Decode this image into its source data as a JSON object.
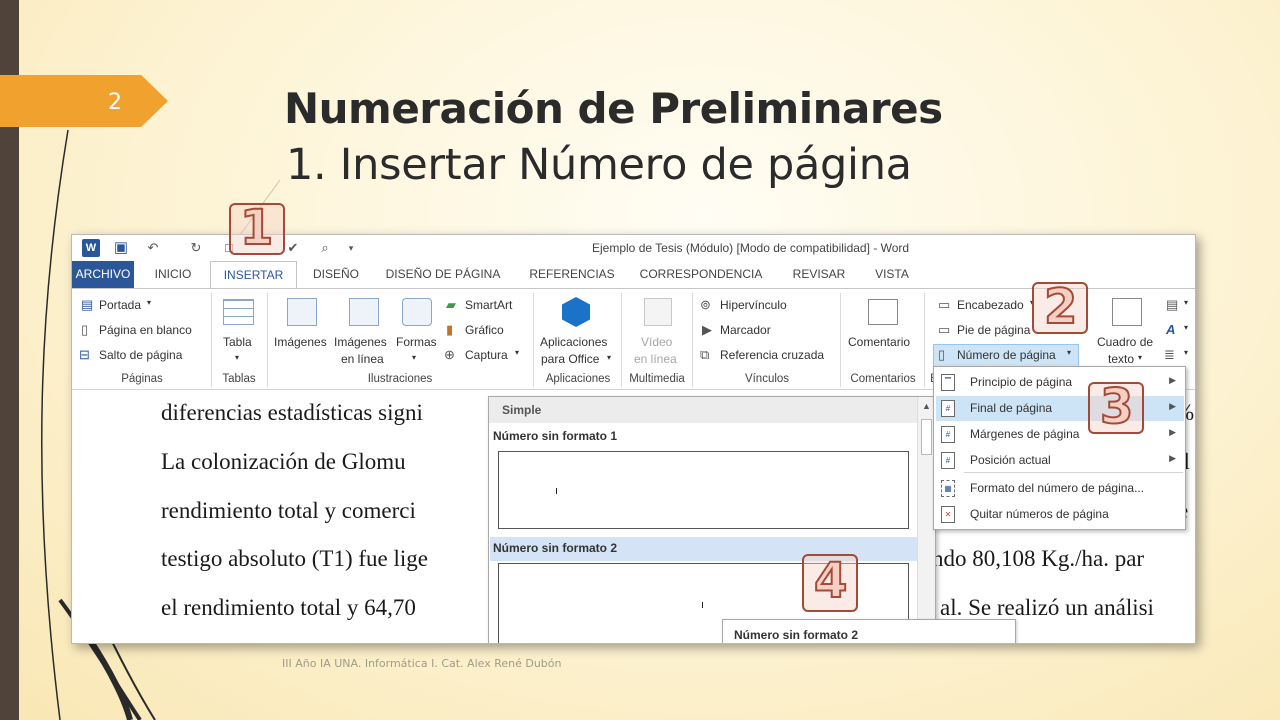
{
  "slide": {
    "number": "2",
    "title": "Numeración de Preliminares",
    "subtitle": "1. Insertar Número de página",
    "footer": "III Año IA UNA. Informática I. Cat. Alex René Dubón"
  },
  "word": {
    "window_title": "Ejemplo de Tesis (Módulo) [Modo de compatibilidad] - Word",
    "tabs": [
      "ARCHIVO",
      "INICIO",
      "INSERTAR",
      "DISEÑO",
      "DISEÑO DE PÁGINA",
      "REFERENCIAS",
      "CORRESPONDENCIA",
      "REVISAR",
      "VISTA"
    ],
    "active_tab": "INSERTAR",
    "ribbon": {
      "paginas": {
        "label": "Páginas",
        "items": [
          "Portada",
          "Página en blanco",
          "Salto de página"
        ]
      },
      "tablas": {
        "label": "Tablas",
        "items": [
          "Tabla"
        ]
      },
      "ilustraciones": {
        "label": "Ilustraciones",
        "items": [
          "Imágenes",
          "Imágenes",
          "en línea",
          "Formas",
          "SmartArt",
          "Gráfico",
          "Captura"
        ]
      },
      "aplicaciones": {
        "label": "Aplicaciones",
        "items": [
          "Aplicaciones",
          "para Office"
        ]
      },
      "multimedia": {
        "label": "Multimedia",
        "items": [
          "Vídeo",
          "en línea"
        ]
      },
      "vinculos": {
        "label": "Vínculos",
        "items": [
          "Hipervínculo",
          "Marcador",
          "Referencia cruzada"
        ]
      },
      "comentarios": {
        "label": "Comentarios",
        "items": [
          "Comentario"
        ]
      },
      "encabezado": {
        "label": "E",
        "items": [
          "Encabezado",
          "Pie de página",
          "Número de página"
        ]
      },
      "texto": {
        "items": [
          "Cuadro de",
          "texto"
        ]
      }
    },
    "document_lines": [
      "diferencias estadísticas signi",
      "La colonización de Glomu",
      "rendimiento total y comerci",
      "testigo absoluto (T1) fue lige",
      "el rendimiento total y 64,70"
    ],
    "document_lines_right": [
      "%",
      "ol",
      "e",
      "ndo 80,108 Kg./ha. par",
      "al. Se realizó un análisi"
    ],
    "gallery": {
      "header": "Simple",
      "items": [
        "Número sin formato 1",
        "Número sin formato 2"
      ]
    },
    "tooltip": "Número sin formato 2",
    "menu": {
      "items": [
        "Principio de página",
        "Final de página",
        "Márgenes de página",
        "Posición actual",
        "Formato del número de página...",
        "Quitar números de página"
      ],
      "highlighted": "Final de página"
    }
  },
  "step_badges": [
    "1",
    "2",
    "3",
    "4"
  ],
  "colors": {
    "accent": "#f0a12e",
    "word_blue": "#2b579a",
    "badge": "#a34b38"
  }
}
